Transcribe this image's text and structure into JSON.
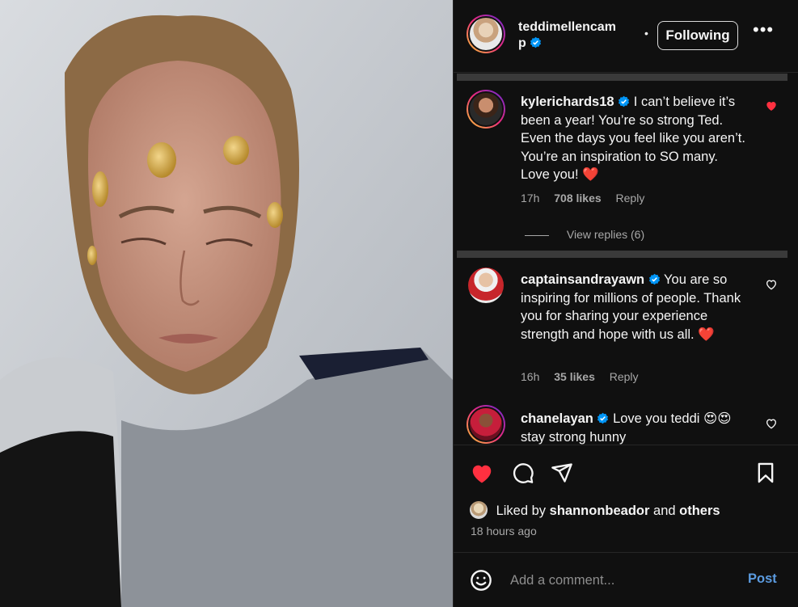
{
  "post": {
    "author": {
      "username": "teddimellencamp",
      "verified": true,
      "follow_label": "Following",
      "more_label": "•••",
      "separator": "•"
    },
    "photo_description_icon": "photo",
    "comments": [
      {
        "username": "kylerichards18",
        "verified": true,
        "text": "I can’t believe it’s been a year! You’re so strong Ted. Even the days you feel like you aren’t. You’re an inspiration to SO many. Love you! ❤️",
        "time": "17h",
        "likes": "708 likes",
        "reply_label": "Reply",
        "liked": true,
        "view_replies": "View replies (6)"
      },
      {
        "username": "captainsandrayawn",
        "verified": true,
        "text": "You are so inspiring for millions of people. Thank you for sharing your experience strength and hope with us all. ❤️",
        "time": "16h",
        "likes": "35 likes",
        "reply_label": "Reply",
        "liked": false
      },
      {
        "username": "chanelayan",
        "verified": true,
        "text": "Love you teddi 😍😍 stay strong hunny",
        "liked": false
      }
    ],
    "likes_summary": {
      "prefix": "Liked by",
      "user": "shannonbeador",
      "middle": "and",
      "suffix": "others"
    },
    "time_ago": "18 hours ago",
    "add_comment": {
      "placeholder": "Add a comment...",
      "post_label": "Post"
    }
  },
  "colors": {
    "panel_bg": "#101010",
    "like_red": "#ff3040",
    "post_blue": "#5b9be0",
    "verified_blue": "#0095f6",
    "muted_text": "#a8a8a8"
  }
}
